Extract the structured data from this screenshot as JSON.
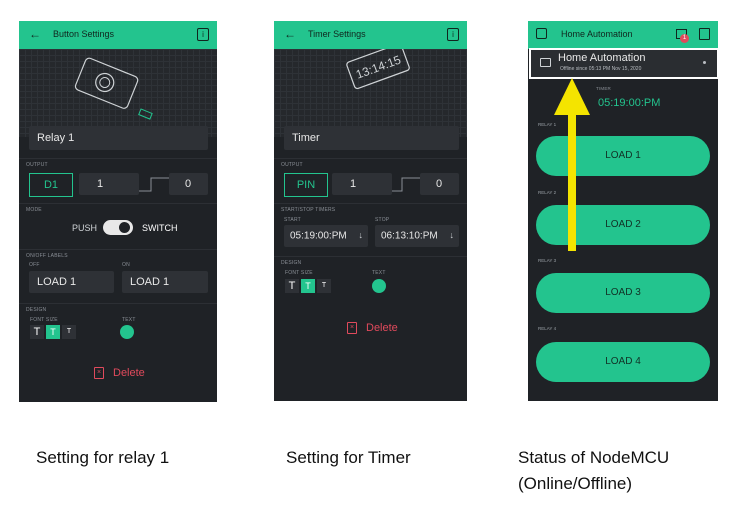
{
  "panel1": {
    "header": "Button Settings",
    "name_value": "Relay 1",
    "output_label": "OUTPUT",
    "pin": "D1",
    "val_on": "1",
    "val_off": "0",
    "mode_label": "MODE",
    "push": "PUSH",
    "switch": "SWITCH",
    "labels_label": "ON/OFF LABELS",
    "off_label": "OFF",
    "on_label": "ON",
    "off_value": "LOAD 1",
    "on_value": "LOAD 1",
    "design_label": "DESIGN",
    "font_size_label": "FONT SIZE",
    "text_label": "TEXT",
    "font_btn": "T",
    "delete": "Delete"
  },
  "panel2": {
    "header": "Timer Settings",
    "name_value": "Timer",
    "output_label": "OUTPUT",
    "pin": "PIN",
    "val_on": "1",
    "val_off": "0",
    "timers_label": "START/STOP TIMERS",
    "start_label": "START",
    "stop_label": "STOP",
    "start_value": "05:19:00:PM",
    "stop_value": "06:13:10:PM",
    "design_label": "DESIGN",
    "font_size_label": "FONT SIZE",
    "text_label": "TEXT",
    "font_btn": "T",
    "delete": "Delete",
    "device_display": "13:14:15"
  },
  "panel3": {
    "header": "Home Automation",
    "badge": "1",
    "popup_title": "Home Automation",
    "popup_status": "Offline since 05:13 PM Nov 15, 2020",
    "timer_label": "TIMER",
    "timer_value": "05:19:00:PM",
    "relays": [
      {
        "label": "RELAY 1",
        "button": "LOAD 1"
      },
      {
        "label": "RELAY 2",
        "button": "LOAD 2"
      },
      {
        "label": "RELAY 3",
        "button": "LOAD 3"
      },
      {
        "label": "RELAY 4",
        "button": "LOAD 4"
      }
    ]
  },
  "captions": {
    "c1": "Setting for relay 1",
    "c2": "Setting for Timer",
    "c3a": "Status of NodeMCU",
    "c3b": "(Online/Offline)"
  },
  "colors": {
    "accent": "#23c48e",
    "background": "#1f2226",
    "delete": "#e04a5c",
    "arrow": "#f4e400"
  }
}
